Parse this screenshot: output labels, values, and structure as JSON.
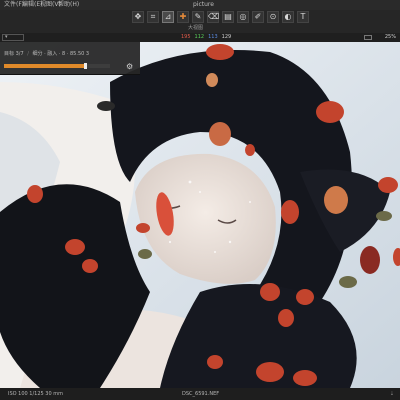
{
  "menu": {
    "items": [
      "文件(F)",
      "编辑(E)",
      "视图(V)",
      "帮助(H)"
    ],
    "title": "picture"
  },
  "toolbar": {
    "tools": [
      {
        "name": "pan-icon",
        "glyph": "✥"
      },
      {
        "name": "crop-icon",
        "glyph": "⌗"
      },
      {
        "name": "straighten-icon",
        "glyph": "⊿"
      },
      {
        "name": "heal-icon",
        "glyph": "✚"
      },
      {
        "name": "brush-icon",
        "glyph": "✎"
      },
      {
        "name": "eraser-icon",
        "glyph": "⌫"
      },
      {
        "name": "gradient-icon",
        "glyph": "▤"
      },
      {
        "name": "radial-icon",
        "glyph": "◎"
      },
      {
        "name": "picker-icon",
        "glyph": "✐"
      },
      {
        "name": "color-picker-icon",
        "glyph": "⊙"
      },
      {
        "name": "mask-icon",
        "glyph": "◐"
      },
      {
        "name": "text-icon",
        "glyph": "T"
      }
    ]
  },
  "view_name": "大视图",
  "status": {
    "rgb": [
      "195",
      "112",
      "113",
      "129"
    ],
    "zoom": "25%"
  },
  "panel": {
    "tab_left": "目标 3/7",
    "tab_right": "细分 · 融入 · 8 · 85.50 3",
    "progress": 0.76
  },
  "bottom": {
    "lens": "ISO 100   1/125   30 mm",
    "filename": "DSC_6591.NEF",
    "arrow": "⇣"
  },
  "colors": {
    "accent": "#e08a2a",
    "panel_bg": "#262626"
  }
}
